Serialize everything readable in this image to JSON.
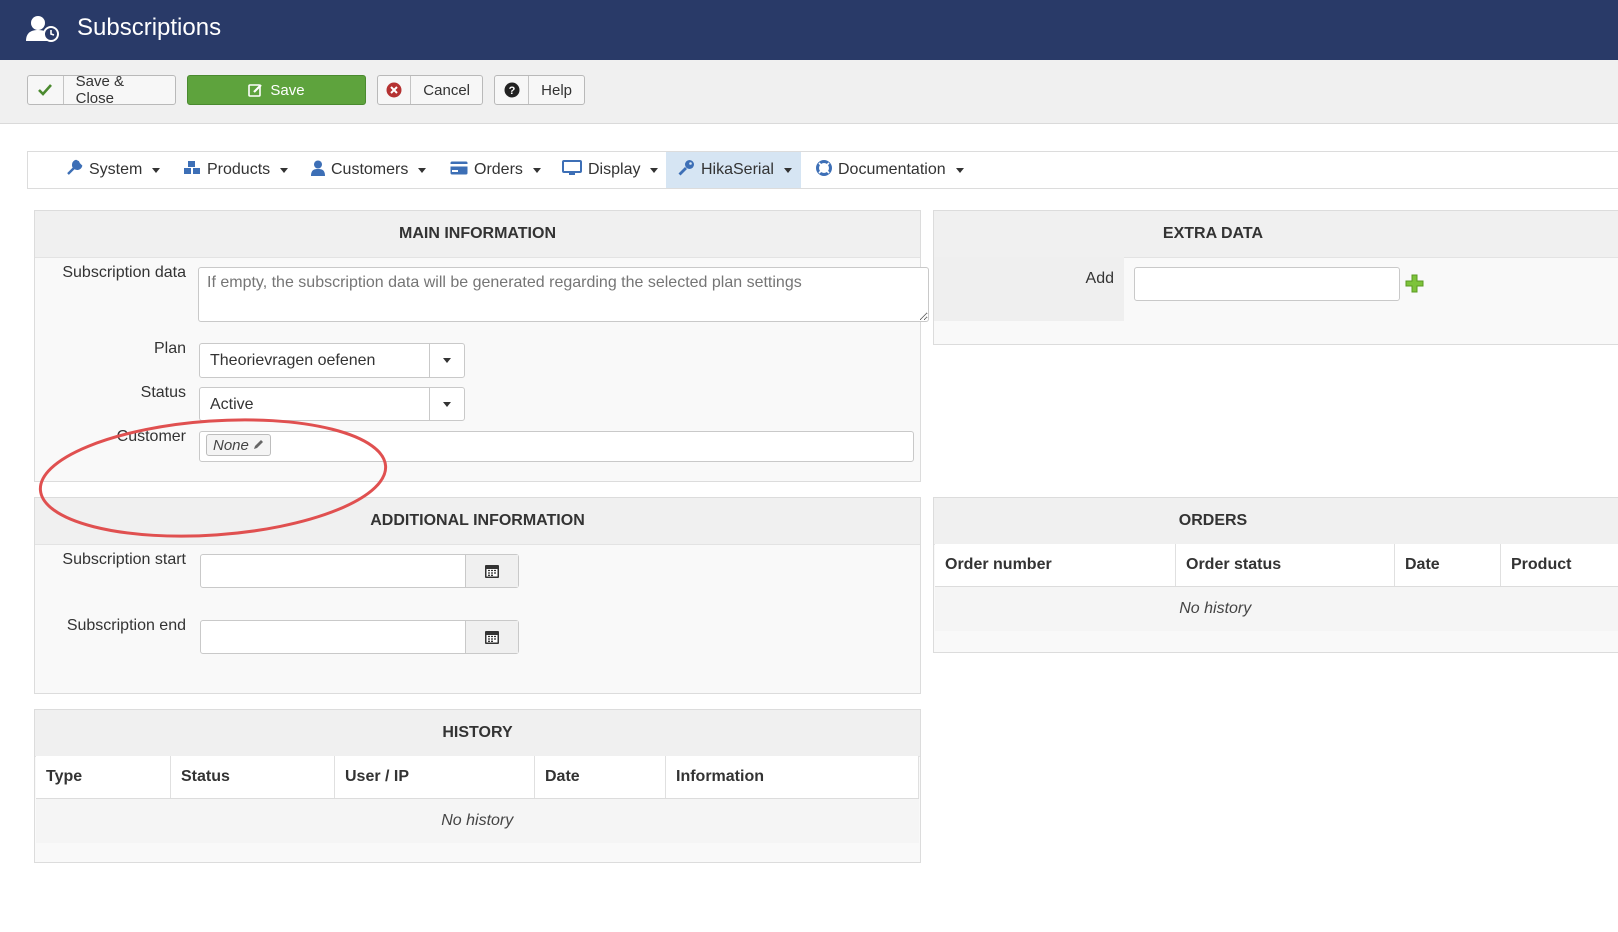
{
  "header": {
    "title": "Subscriptions",
    "icon": "user-clock-icon"
  },
  "toolbar": {
    "save_close": "Save & Close",
    "save": "Save",
    "cancel": "Cancel",
    "help": "Help"
  },
  "nav": {
    "items": [
      {
        "label": "System",
        "icon": "wrench-icon"
      },
      {
        "label": "Products",
        "icon": "cubes-icon"
      },
      {
        "label": "Customers",
        "icon": "user-icon"
      },
      {
        "label": "Orders",
        "icon": "credit-card-icon"
      },
      {
        "label": "Display",
        "icon": "monitor-icon"
      },
      {
        "label": "HikaSerial",
        "icon": "key-icon",
        "active": true
      },
      {
        "label": "Documentation",
        "icon": "lifebuoy-icon"
      }
    ]
  },
  "main_info": {
    "title": "MAIN INFORMATION",
    "subscription_data_label": "Subscription data",
    "subscription_data_placeholder": "If empty, the subscription data will be generated regarding the selected plan settings",
    "plan_label": "Plan",
    "plan_value": "Theorievragen oefenen",
    "status_label": "Status",
    "status_value": "Active",
    "customer_label": "Customer",
    "customer_value": "None"
  },
  "extra_data": {
    "title": "EXTRA DATA",
    "add_label": "Add"
  },
  "additional_info": {
    "title": "ADDITIONAL INFORMATION",
    "start_label": "Subscription start",
    "end_label": "Subscription end"
  },
  "orders": {
    "title": "ORDERS",
    "columns": [
      "Order number",
      "Order status",
      "Date",
      "Product"
    ],
    "empty": "No history"
  },
  "history": {
    "title": "HISTORY",
    "columns": [
      "Type",
      "Status",
      "User / IP",
      "Date",
      "Information"
    ],
    "empty": "No history"
  },
  "colors": {
    "header_bg": "#293a68",
    "save_green": "#5ea33d",
    "annotation_red": "#e05050"
  }
}
